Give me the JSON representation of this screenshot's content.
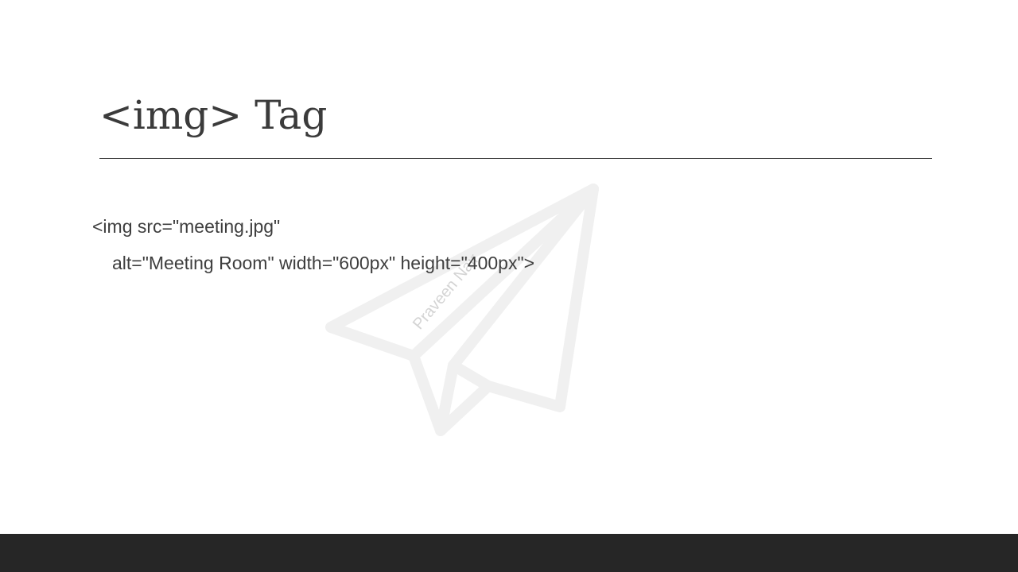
{
  "slide": {
    "title": "<img> Tag",
    "code_lines": [
      "<img src=\"meeting.jpg\"",
      "alt=\"Meeting Room\" width=\"600px\" height=\"400px\">"
    ],
    "watermark": {
      "icon": "paper-plane-icon",
      "text": "Praveen Nair"
    }
  },
  "colors": {
    "title": "#3b3b3b",
    "body_text": "#3e3e3e",
    "footer_bar": "#262626",
    "watermark": "#f0f0f0"
  }
}
